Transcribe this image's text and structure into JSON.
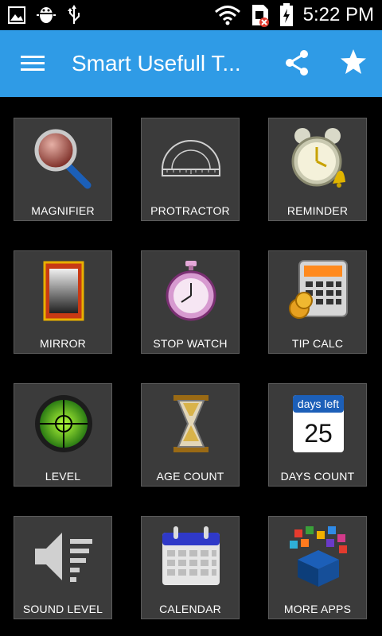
{
  "status_bar": {
    "time": "5:22 PM",
    "icons": [
      "image-icon",
      "android-debug-icon",
      "usb-icon",
      "wifi-icon",
      "sim-error-icon",
      "battery-charging-icon"
    ]
  },
  "app_bar": {
    "title": "Smart Usefull T...",
    "icons": [
      "menu-icon",
      "share-icon",
      "star-icon"
    ],
    "background": "#2f9be6"
  },
  "tiles": [
    {
      "label": "MAGNIFIER",
      "icon": "magnifier-icon"
    },
    {
      "label": "PROTRACTOR",
      "icon": "protractor-icon"
    },
    {
      "label": "REMINDER",
      "icon": "alarm-clock-icon"
    },
    {
      "label": "MIRROR",
      "icon": "mirror-icon"
    },
    {
      "label": "STOP WATCH",
      "icon": "stopwatch-icon"
    },
    {
      "label": "TIP CALC",
      "icon": "calculator-icon"
    },
    {
      "label": "LEVEL",
      "icon": "level-icon"
    },
    {
      "label": "AGE COUNT",
      "icon": "hourglass-icon"
    },
    {
      "label": "DAYS COUNT",
      "icon": "days-left-icon",
      "icon_text_top": "days left",
      "icon_text_number": "25"
    },
    {
      "label": "SOUND LEVEL",
      "icon": "speaker-icon"
    },
    {
      "label": "CALENDAR",
      "icon": "calendar-icon"
    },
    {
      "label": "MORE APPS",
      "icon": "more-apps-icon"
    }
  ]
}
